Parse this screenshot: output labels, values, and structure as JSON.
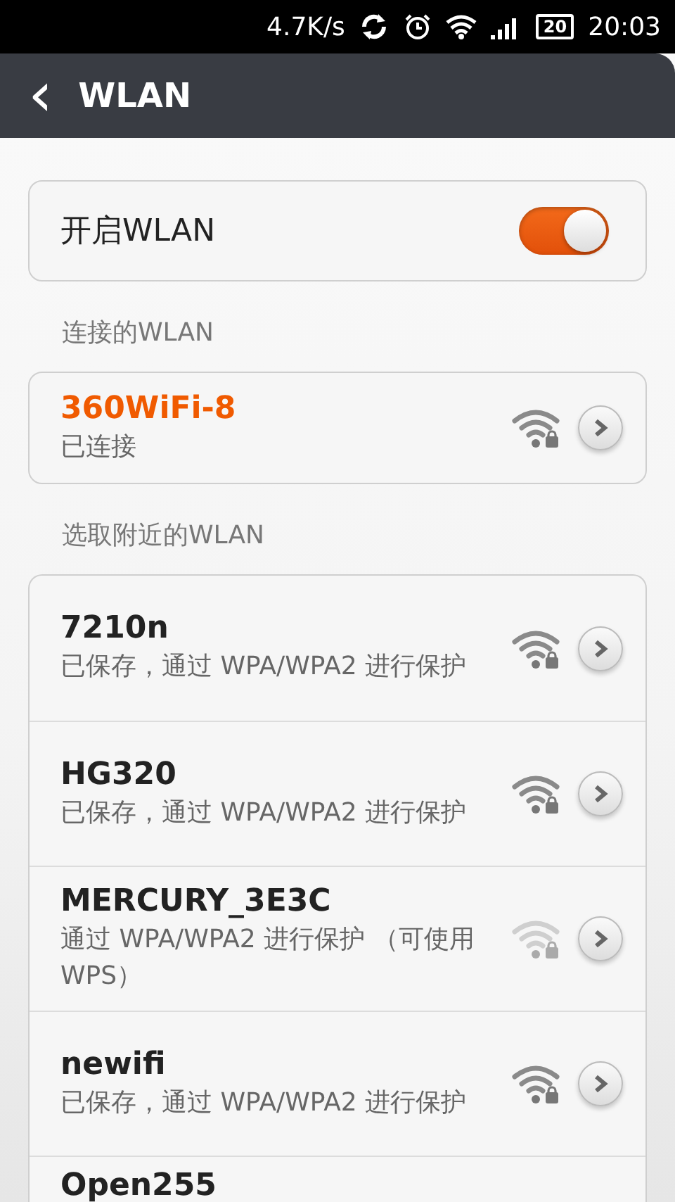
{
  "status_bar": {
    "speed": "4.7K/s",
    "battery": "20",
    "time": "20:03"
  },
  "header": {
    "back": "‹",
    "title": "WLAN"
  },
  "wlan_toggle": {
    "label": "开启WLAN",
    "on": true
  },
  "connected_section": {
    "label": "连接的WLAN",
    "network": {
      "name": "360WiFi-8",
      "status": "已连接",
      "weak_signal": false
    }
  },
  "nearby_section": {
    "label": "选取附近的WLAN",
    "networks": [
      {
        "name": "7210n",
        "status": "已保存，通过 WPA/WPA2 进行保护",
        "weak_signal": false
      },
      {
        "name": "HG320",
        "status": "已保存，通过 WPA/WPA2 进行保护",
        "weak_signal": false
      },
      {
        "name": "MERCURY_3E3C",
        "status": "通过 WPA/WPA2 进行保护 （可使用 WPS）",
        "weak_signal": true
      },
      {
        "name": "newifi",
        "status": "已保存，通过 WPA/WPA2 进行保护",
        "weak_signal": false
      },
      {
        "name": "Open255"
      }
    ]
  }
}
